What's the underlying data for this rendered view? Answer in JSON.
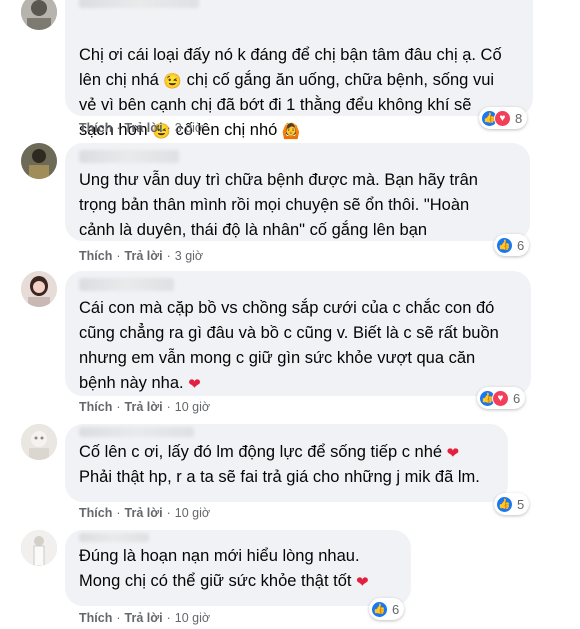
{
  "comments": [
    {
      "text_parts": [
        "Chị ơi cái loại đấy nó k đáng để chị bận tâm đâu chị ạ. Cố\nlên chị nhá ",
        "😉",
        " chị cố gắng ăn uống, chữa bệnh, sống vui\nvẻ vì bên cạnh chị đã bớt đi 1 thằng đểu không khí sẽ\nsạch hơn ",
        "😉",
        " cố lên chị nhó ",
        "🙆"
      ],
      "like_label": "Thích",
      "reply_label": "Trả lời",
      "time": "3 giờ",
      "reactions": [
        "like",
        "love"
      ],
      "count": "8"
    },
    {
      "text_parts": [
        "Ung thư vẫn duy trì chữa bệnh được mà. Bạn hãy trân\ntrọng bản thân mình rồi mọi chuyện sẽ ổn thôi. \"Hoàn\ncảnh là duyên, thái độ là nhân\" cố gắng lên bạn"
      ],
      "like_label": "Thích",
      "reply_label": "Trả lời",
      "time": "3 giờ",
      "reactions": [
        "like"
      ],
      "count": "6"
    },
    {
      "text_parts": [
        "Cái con mà cặp bồ vs chồng sắp cưới của c chắc con đó\ncũng chẳng ra gì đâu và bồ c cũng v. Biết là c sẽ rất buồn\nnhưng em vẫn mong c giữ gìn sức khỏe vượt qua căn\nbệnh này nha. ",
        "❤"
      ],
      "like_label": "Thích",
      "reply_label": "Trả lời",
      "time": "10 giờ",
      "reactions": [
        "like",
        "love"
      ],
      "count": "6"
    },
    {
      "text_parts": [
        "Cố lên c ơi, lấy đó lm động lực để sống tiếp c nhé ",
        "❤",
        "\nPhải thật hp, r a ta sẽ fai trả giá cho những j mik đã lm."
      ],
      "like_label": "Thích",
      "reply_label": "Trả lời",
      "time": "10 giờ",
      "reactions": [
        "like"
      ],
      "count": "5"
    },
    {
      "text_parts": [
        "Đúng là hoạn nạn mới hiểu lòng nhau.\nMong chị có thể giữ sức khỏe thật tốt ",
        "❤"
      ],
      "like_label": "Thích",
      "reply_label": "Trả lời",
      "time": "10 giờ",
      "reactions": [
        "like"
      ],
      "count": "6"
    }
  ],
  "colors": {
    "bubble": "#f0f2f5",
    "meta_text": "#65676b",
    "like_blue": "#1877f2",
    "love_red": "#f33e58",
    "heart": "#e41e3f"
  },
  "icons": {
    "like": "thumbs-up-icon",
    "love": "heart-icon"
  }
}
